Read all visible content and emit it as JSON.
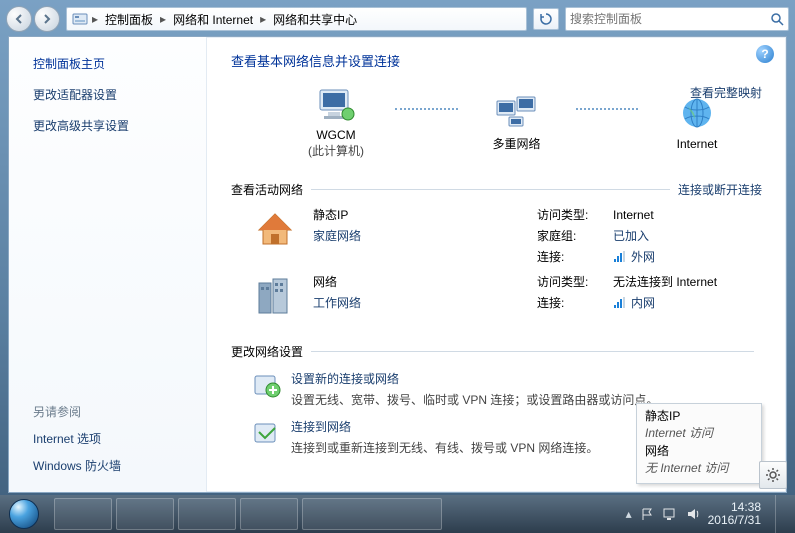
{
  "breadcrumb": {
    "items": [
      "控制面板",
      "网络和 Internet",
      "网络和共享中心"
    ]
  },
  "search": {
    "placeholder": "搜索控制面板"
  },
  "sidebar": {
    "title": "控制面板主页",
    "links": [
      "更改适配器设置",
      "更改高级共享设置"
    ],
    "see_also_title": "另请参阅",
    "see_also": [
      "Internet 选项",
      "Windows 防火墙"
    ]
  },
  "main": {
    "heading": "查看基本网络信息并设置连接",
    "map_nodes": {
      "computer": {
        "label": "WGCM",
        "sub": "(此计算机)"
      },
      "multi": {
        "label": "多重网络"
      },
      "internet": {
        "label": "Internet"
      }
    },
    "view_full_map": "查看完整映射",
    "section_active": "查看活动网络",
    "disconnect_link": "连接或断开连接",
    "networks": [
      {
        "name": "静态IP",
        "type": "家庭网络",
        "rows": [
          {
            "k": "访问类型:",
            "v": "Internet",
            "plain": true
          },
          {
            "k": "家庭组:",
            "v": "已加入"
          },
          {
            "k": "连接:",
            "v": "外网",
            "icon": true
          }
        ]
      },
      {
        "name": "网络",
        "type": "工作网络",
        "rows": [
          {
            "k": "访问类型:",
            "v": "无法连接到 Internet",
            "plain": true
          },
          {
            "k": "连接:",
            "v": "内网",
            "icon": true
          }
        ]
      }
    ],
    "section_settings": "更改网络设置",
    "tasks": [
      {
        "title": "设置新的连接或网络",
        "desc": "设置无线、宽带、拨号、临时或 VPN 连接；或设置路由器或访问点。"
      },
      {
        "title": "连接到网络",
        "desc": "连接到或重新连接到无线、有线、拨号或 VPN 网络连接。"
      }
    ]
  },
  "tooltip": {
    "rows": [
      {
        "name": "静态IP",
        "status": "Internet 访问"
      },
      {
        "name": "网络",
        "status": "无 Internet 访问"
      }
    ]
  },
  "taskbar": {
    "time": "14:38",
    "date": "2016/7/31"
  }
}
